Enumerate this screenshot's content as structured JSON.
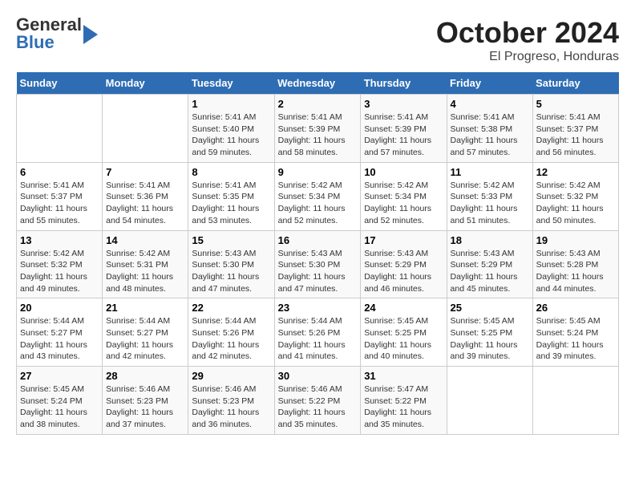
{
  "header": {
    "logo_general": "General",
    "logo_blue": "Blue",
    "month_title": "October 2024",
    "location": "El Progreso, Honduras"
  },
  "weekdays": [
    "Sunday",
    "Monday",
    "Tuesday",
    "Wednesday",
    "Thursday",
    "Friday",
    "Saturday"
  ],
  "weeks": [
    [
      {
        "day": "",
        "info": ""
      },
      {
        "day": "",
        "info": ""
      },
      {
        "day": "1",
        "info": "Sunrise: 5:41 AM\nSunset: 5:40 PM\nDaylight: 11 hours\nand 59 minutes."
      },
      {
        "day": "2",
        "info": "Sunrise: 5:41 AM\nSunset: 5:39 PM\nDaylight: 11 hours\nand 58 minutes."
      },
      {
        "day": "3",
        "info": "Sunrise: 5:41 AM\nSunset: 5:39 PM\nDaylight: 11 hours\nand 57 minutes."
      },
      {
        "day": "4",
        "info": "Sunrise: 5:41 AM\nSunset: 5:38 PM\nDaylight: 11 hours\nand 57 minutes."
      },
      {
        "day": "5",
        "info": "Sunrise: 5:41 AM\nSunset: 5:37 PM\nDaylight: 11 hours\nand 56 minutes."
      }
    ],
    [
      {
        "day": "6",
        "info": "Sunrise: 5:41 AM\nSunset: 5:37 PM\nDaylight: 11 hours\nand 55 minutes."
      },
      {
        "day": "7",
        "info": "Sunrise: 5:41 AM\nSunset: 5:36 PM\nDaylight: 11 hours\nand 54 minutes."
      },
      {
        "day": "8",
        "info": "Sunrise: 5:41 AM\nSunset: 5:35 PM\nDaylight: 11 hours\nand 53 minutes."
      },
      {
        "day": "9",
        "info": "Sunrise: 5:42 AM\nSunset: 5:34 PM\nDaylight: 11 hours\nand 52 minutes."
      },
      {
        "day": "10",
        "info": "Sunrise: 5:42 AM\nSunset: 5:34 PM\nDaylight: 11 hours\nand 52 minutes."
      },
      {
        "day": "11",
        "info": "Sunrise: 5:42 AM\nSunset: 5:33 PM\nDaylight: 11 hours\nand 51 minutes."
      },
      {
        "day": "12",
        "info": "Sunrise: 5:42 AM\nSunset: 5:32 PM\nDaylight: 11 hours\nand 50 minutes."
      }
    ],
    [
      {
        "day": "13",
        "info": "Sunrise: 5:42 AM\nSunset: 5:32 PM\nDaylight: 11 hours\nand 49 minutes."
      },
      {
        "day": "14",
        "info": "Sunrise: 5:42 AM\nSunset: 5:31 PM\nDaylight: 11 hours\nand 48 minutes."
      },
      {
        "day": "15",
        "info": "Sunrise: 5:43 AM\nSunset: 5:30 PM\nDaylight: 11 hours\nand 47 minutes."
      },
      {
        "day": "16",
        "info": "Sunrise: 5:43 AM\nSunset: 5:30 PM\nDaylight: 11 hours\nand 47 minutes."
      },
      {
        "day": "17",
        "info": "Sunrise: 5:43 AM\nSunset: 5:29 PM\nDaylight: 11 hours\nand 46 minutes."
      },
      {
        "day": "18",
        "info": "Sunrise: 5:43 AM\nSunset: 5:29 PM\nDaylight: 11 hours\nand 45 minutes."
      },
      {
        "day": "19",
        "info": "Sunrise: 5:43 AM\nSunset: 5:28 PM\nDaylight: 11 hours\nand 44 minutes."
      }
    ],
    [
      {
        "day": "20",
        "info": "Sunrise: 5:44 AM\nSunset: 5:27 PM\nDaylight: 11 hours\nand 43 minutes."
      },
      {
        "day": "21",
        "info": "Sunrise: 5:44 AM\nSunset: 5:27 PM\nDaylight: 11 hours\nand 42 minutes."
      },
      {
        "day": "22",
        "info": "Sunrise: 5:44 AM\nSunset: 5:26 PM\nDaylight: 11 hours\nand 42 minutes."
      },
      {
        "day": "23",
        "info": "Sunrise: 5:44 AM\nSunset: 5:26 PM\nDaylight: 11 hours\nand 41 minutes."
      },
      {
        "day": "24",
        "info": "Sunrise: 5:45 AM\nSunset: 5:25 PM\nDaylight: 11 hours\nand 40 minutes."
      },
      {
        "day": "25",
        "info": "Sunrise: 5:45 AM\nSunset: 5:25 PM\nDaylight: 11 hours\nand 39 minutes."
      },
      {
        "day": "26",
        "info": "Sunrise: 5:45 AM\nSunset: 5:24 PM\nDaylight: 11 hours\nand 39 minutes."
      }
    ],
    [
      {
        "day": "27",
        "info": "Sunrise: 5:45 AM\nSunset: 5:24 PM\nDaylight: 11 hours\nand 38 minutes."
      },
      {
        "day": "28",
        "info": "Sunrise: 5:46 AM\nSunset: 5:23 PM\nDaylight: 11 hours\nand 37 minutes."
      },
      {
        "day": "29",
        "info": "Sunrise: 5:46 AM\nSunset: 5:23 PM\nDaylight: 11 hours\nand 36 minutes."
      },
      {
        "day": "30",
        "info": "Sunrise: 5:46 AM\nSunset: 5:22 PM\nDaylight: 11 hours\nand 35 minutes."
      },
      {
        "day": "31",
        "info": "Sunrise: 5:47 AM\nSunset: 5:22 PM\nDaylight: 11 hours\nand 35 minutes."
      },
      {
        "day": "",
        "info": ""
      },
      {
        "day": "",
        "info": ""
      }
    ]
  ]
}
